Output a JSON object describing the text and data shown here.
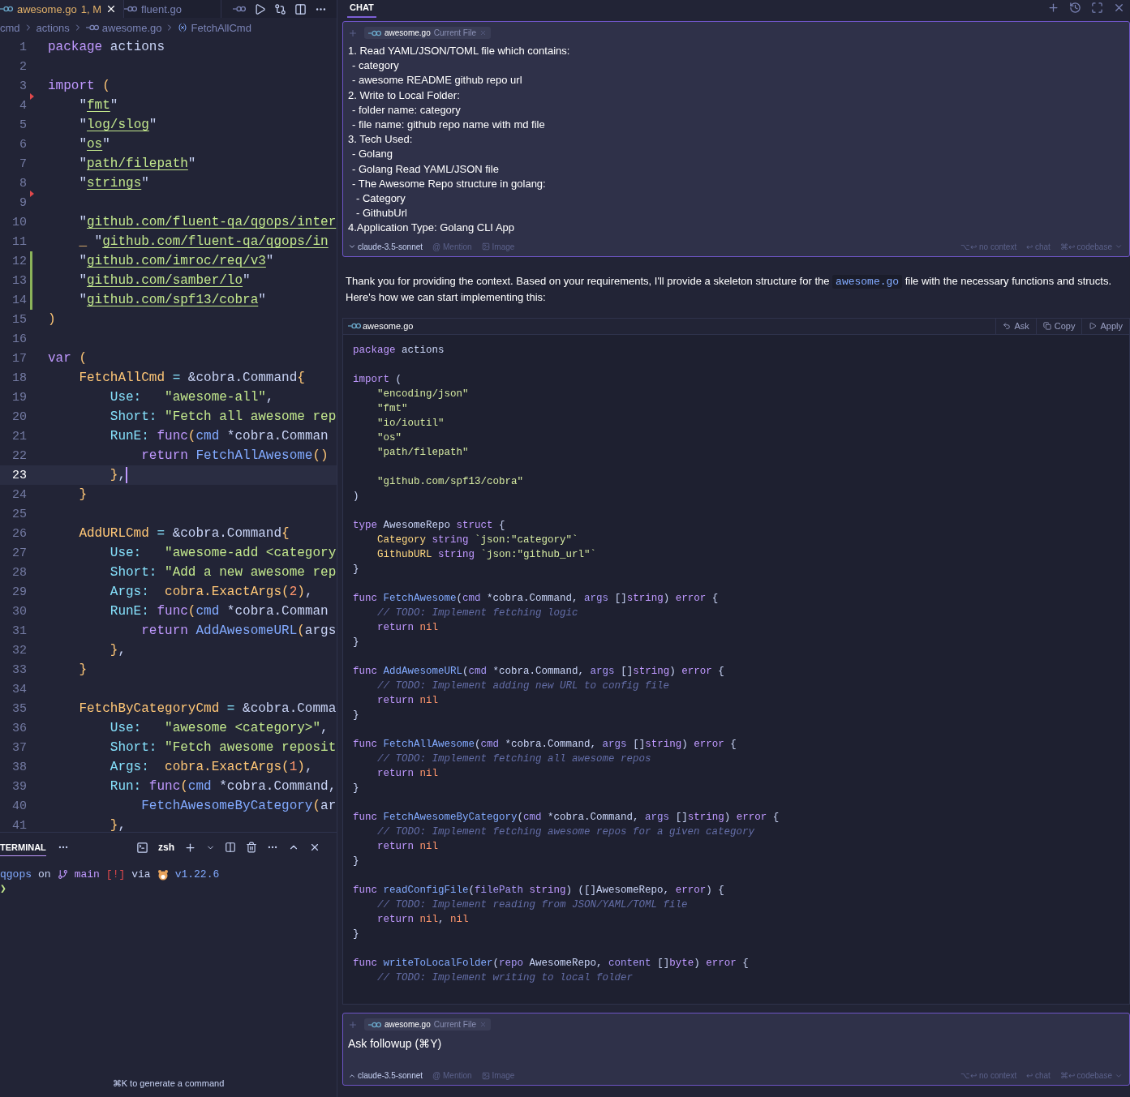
{
  "editor": {
    "tabs": [
      {
        "label": "awesome.go",
        "badge": "1, M",
        "selected": true
      },
      {
        "label": "fluent.go",
        "selected": false
      }
    ],
    "breadcrumb": [
      "cmd",
      "actions",
      "awesome.go",
      "FetchAllCmd"
    ],
    "lines": [
      {
        "number": "1",
        "active": false,
        "tokens": [
          {
            "kind": "k",
            "text": "package"
          },
          {
            "kind": "x",
            "text": " actions"
          }
        ]
      },
      {
        "number": "2",
        "active": false
      },
      {
        "number": "3",
        "active": false,
        "tokens": [
          {
            "kind": "k",
            "text": "import"
          },
          {
            "kind": "o",
            "text": " ("
          }
        ]
      },
      {
        "number": "4",
        "active": false,
        "kind": "deleted",
        "tokens": [
          {
            "kind": "x",
            "text": "    \""
          },
          {
            "kind": "u",
            "text": "fmt"
          },
          {
            "kind": "x",
            "text": "\""
          }
        ]
      },
      {
        "number": "5",
        "active": false,
        "tokens": [
          {
            "kind": "x",
            "text": "    \""
          },
          {
            "kind": "u",
            "text": "log/slog"
          },
          {
            "kind": "x",
            "text": "\""
          }
        ]
      },
      {
        "number": "6",
        "active": false,
        "tokens": [
          {
            "kind": "x",
            "text": "    \""
          },
          {
            "kind": "u",
            "text": "os"
          },
          {
            "kind": "x",
            "text": "\""
          }
        ]
      },
      {
        "number": "7",
        "active": false,
        "tokens": [
          {
            "kind": "x",
            "text": "    \""
          },
          {
            "kind": "u",
            "text": "path/filepath"
          },
          {
            "kind": "x",
            "text": "\""
          }
        ]
      },
      {
        "number": "8",
        "active": false,
        "tokens": [
          {
            "kind": "x",
            "text": "    \""
          },
          {
            "kind": "u",
            "text": "strings"
          },
          {
            "kind": "x",
            "text": "\""
          }
        ]
      },
      {
        "number": "9",
        "active": false,
        "kind": "deleted"
      },
      {
        "number": "10",
        "active": false,
        "tokens": [
          {
            "kind": "x",
            "text": "    \""
          },
          {
            "kind": "u",
            "text": "github.com/fluent-qa/qgops/inter"
          }
        ]
      },
      {
        "number": "11",
        "active": false,
        "tokens": [
          {
            "kind": "o",
            "text": "    _"
          },
          {
            "kind": "x",
            "text": " \""
          },
          {
            "kind": "u",
            "text": "github.com/fluent-qa/qgops/in"
          }
        ]
      },
      {
        "number": "12",
        "active": false,
        "kind": "added",
        "tokens": [
          {
            "kind": "x",
            "text": "    \""
          },
          {
            "kind": "u",
            "text": "github.com/imroc/req/v3"
          },
          {
            "kind": "x",
            "text": "\""
          }
        ]
      },
      {
        "number": "13",
        "active": false,
        "kind": "added",
        "tokens": [
          {
            "kind": "x",
            "text": "    \""
          },
          {
            "kind": "u",
            "text": "github.com/samber/lo"
          },
          {
            "kind": "x",
            "text": "\""
          }
        ]
      },
      {
        "number": "14",
        "active": false,
        "kind": "added",
        "tokens": [
          {
            "kind": "x",
            "text": "    \""
          },
          {
            "kind": "u",
            "text": "github.com/spf13/cobra"
          },
          {
            "kind": "x",
            "text": "\""
          }
        ]
      },
      {
        "number": "15",
        "active": false,
        "tokens": [
          {
            "kind": "o",
            "text": ")"
          }
        ]
      },
      {
        "number": "16",
        "active": false
      },
      {
        "number": "17",
        "active": false,
        "tokens": [
          {
            "kind": "k",
            "text": "var"
          },
          {
            "kind": "o",
            "text": " ("
          }
        ]
      },
      {
        "number": "18",
        "active": false,
        "tokens": [
          {
            "kind": "v",
            "text": "    FetchAllCmd"
          },
          {
            "kind": "y",
            "text": " = "
          },
          {
            "kind": "x",
            "text": "&cobra.Command"
          },
          {
            "kind": "o",
            "text": "{"
          }
        ]
      },
      {
        "number": "19",
        "active": false,
        "tokens": [
          {
            "kind": "y",
            "text": "        Use:"
          },
          {
            "kind": "s",
            "text": "   \"awesome-all\""
          },
          {
            "kind": "x",
            "text": ","
          }
        ]
      },
      {
        "number": "20",
        "active": false,
        "tokens": [
          {
            "kind": "y",
            "text": "        Short:"
          },
          {
            "kind": "s",
            "text": " \"Fetch all awesome rep"
          }
        ]
      },
      {
        "number": "21",
        "active": false,
        "tokens": [
          {
            "kind": "y",
            "text": "        RunE:"
          },
          {
            "kind": "k",
            "text": " func"
          },
          {
            "kind": "o",
            "text": "("
          },
          {
            "kind": "p",
            "text": "cmd"
          },
          {
            "kind": "x",
            "text": " *cobra.Comman"
          }
        ]
      },
      {
        "number": "22",
        "active": false,
        "tokens": [
          {
            "kind": "k",
            "text": "            return"
          },
          {
            "kind": "f",
            "text": " FetchAllAwesome"
          },
          {
            "kind": "o",
            "text": "()"
          }
        ]
      },
      {
        "number": "23",
        "active": true,
        "tokens": [
          {
            "kind": "o",
            "text": "        }"
          },
          {
            "kind": "x",
            "text": ","
          }
        ]
      },
      {
        "number": "24",
        "active": false,
        "tokens": [
          {
            "kind": "o",
            "text": "    }"
          }
        ]
      },
      {
        "number": "25",
        "active": false
      },
      {
        "number": "26",
        "active": false,
        "tokens": [
          {
            "kind": "v",
            "text": "    AddURLCmd"
          },
          {
            "kind": "y",
            "text": " = "
          },
          {
            "kind": "x",
            "text": "&cobra.Command"
          },
          {
            "kind": "o",
            "text": "{"
          }
        ]
      },
      {
        "number": "27",
        "active": false,
        "tokens": [
          {
            "kind": "y",
            "text": "        Use:"
          },
          {
            "kind": "s",
            "text": "   \"awesome-add <category"
          }
        ]
      },
      {
        "number": "28",
        "active": false,
        "tokens": [
          {
            "kind": "y",
            "text": "        Short:"
          },
          {
            "kind": "s",
            "text": " \"Add a new awesome rep"
          }
        ]
      },
      {
        "number": "29",
        "active": false,
        "tokens": [
          {
            "kind": "y",
            "text": "        Args:"
          },
          {
            "kind": "v",
            "text": "  cobra.ExactArgs"
          },
          {
            "kind": "o",
            "text": "("
          },
          {
            "kind": "n",
            "text": "2"
          },
          {
            "kind": "o",
            "text": ")"
          },
          {
            "kind": "x",
            "text": ","
          }
        ]
      },
      {
        "number": "30",
        "active": false,
        "tokens": [
          {
            "kind": "y",
            "text": "        RunE:"
          },
          {
            "kind": "k",
            "text": " func"
          },
          {
            "kind": "o",
            "text": "("
          },
          {
            "kind": "p",
            "text": "cmd"
          },
          {
            "kind": "x",
            "text": " *cobra.Comman"
          }
        ]
      },
      {
        "number": "31",
        "active": false,
        "tokens": [
          {
            "kind": "k",
            "text": "            return"
          },
          {
            "kind": "f",
            "text": " AddAwesomeURL"
          },
          {
            "kind": "o",
            "text": "("
          },
          {
            "kind": "x",
            "text": "args"
          }
        ]
      },
      {
        "number": "32",
        "active": false,
        "tokens": [
          {
            "kind": "o",
            "text": "        }"
          },
          {
            "kind": "x",
            "text": ","
          }
        ]
      },
      {
        "number": "33",
        "active": false,
        "tokens": [
          {
            "kind": "o",
            "text": "    }"
          }
        ]
      },
      {
        "number": "34",
        "active": false
      },
      {
        "number": "35",
        "active": false,
        "tokens": [
          {
            "kind": "v",
            "text": "    FetchByCategoryCmd"
          },
          {
            "kind": "y",
            "text": " = "
          },
          {
            "kind": "x",
            "text": "&cobra.Comma"
          }
        ]
      },
      {
        "number": "36",
        "active": false,
        "tokens": [
          {
            "kind": "y",
            "text": "        Use:"
          },
          {
            "kind": "s",
            "text": "   \"awesome <category>\""
          },
          {
            "kind": "x",
            "text": ","
          }
        ]
      },
      {
        "number": "37",
        "active": false,
        "tokens": [
          {
            "kind": "y",
            "text": "        Short:"
          },
          {
            "kind": "s",
            "text": " \"Fetch awesome reposit"
          }
        ]
      },
      {
        "number": "38",
        "active": false,
        "tokens": [
          {
            "kind": "y",
            "text": "        Args:"
          },
          {
            "kind": "v",
            "text": "  cobra.ExactArgs"
          },
          {
            "kind": "o",
            "text": "("
          },
          {
            "kind": "n",
            "text": "1"
          },
          {
            "kind": "o",
            "text": ")"
          },
          {
            "kind": "x",
            "text": ","
          }
        ]
      },
      {
        "number": "39",
        "active": false,
        "tokens": [
          {
            "kind": "y",
            "text": "        Run:"
          },
          {
            "kind": "k",
            "text": " func"
          },
          {
            "kind": "o",
            "text": "("
          },
          {
            "kind": "p",
            "text": "cmd"
          },
          {
            "kind": "x",
            "text": " *cobra.Command,"
          }
        ]
      },
      {
        "number": "40",
        "active": false,
        "tokens": [
          {
            "kind": "f",
            "text": "            FetchAwesomeByCategory"
          },
          {
            "kind": "o",
            "text": "("
          },
          {
            "kind": "x",
            "text": "ar"
          }
        ]
      },
      {
        "number": "41",
        "active": false,
        "tokens": [
          {
            "kind": "o",
            "text": "        }"
          },
          {
            "kind": "x",
            "text": ","
          }
        ]
      }
    ]
  },
  "terminal": {
    "tabs": [
      {
        "label": "TERMINAL",
        "selected": true
      }
    ],
    "shell": "zsh",
    "prompt": {
      "dir": "qgops",
      "on": "on",
      "branch": "main",
      "status": "[!]",
      "via": "via",
      "version": "v1.22.6",
      "symbol": "❯"
    },
    "hint": "⌘K to generate a command"
  },
  "chat": {
    "tabs": [
      {
        "label": "CHAT",
        "selected": true
      }
    ],
    "context_message": {
      "chip": {
        "file": "awesome.go",
        "label": "Current File"
      },
      "items": [
        {
          "text": "1. Read YAML/JSON/TOML file which contains:",
          "children": [
            {
              "text": "- category"
            },
            {
              "text": "- awesome README github repo url"
            }
          ]
        },
        {
          "text": "2. Write to Local Folder:",
          "children": [
            {
              "text": "- folder name: category"
            },
            {
              "text": "- file name: github repo name with md file"
            }
          ]
        },
        {
          "text": "3. Tech Used:",
          "children": [
            {
              "text": "- Golang"
            },
            {
              "text": "- Golang Read YAML/JSON file"
            },
            {
              "text": "- The Awesome Repo structure in golang:",
              "children": [
                {
                  "text": "- Category"
                },
                {
                  "text": "- GithubUrl"
                }
              ]
            }
          ]
        },
        {
          "text": "4.Application Type: Golang CLI App"
        }
      ],
      "footer": {
        "model": "claude-3.5-sonnet",
        "mention": "@ Mention",
        "image": "Image",
        "shortcuts": [
          {
            "keys": "⌥↩",
            "label": "no context"
          },
          {
            "keys": "↩",
            "label": "chat"
          },
          {
            "keys": "⌘↩",
            "label": "codebase"
          }
        ]
      }
    },
    "response": {
      "before": "Thank you for providing the context. Based on your requirements, I'll provide a skeleton structure for the ",
      "code": "awesome.go",
      "after": " file with the necessary functions and structs. Here's how we can start implementing this:"
    },
    "code_block": {
      "file": "awesome.go",
      "actions": [
        "Ask",
        "Copy",
        "Apply"
      ],
      "lines": [
        {
          "kind": "code",
          "tokens": [
            {
              "kind": "k",
              "text": "package"
            },
            {
              "kind": "x",
              "text": " actions"
            }
          ]
        },
        {
          "kind": "blank"
        },
        {
          "kind": "code",
          "tokens": [
            {
              "kind": "k",
              "text": "import"
            },
            {
              "kind": "x",
              "text": " ("
            }
          ]
        },
        {
          "kind": "code",
          "tokens": [
            {
              "kind": "s",
              "text": "    \"encoding/json\""
            }
          ]
        },
        {
          "kind": "code",
          "tokens": [
            {
              "kind": "s",
              "text": "    \"fmt\""
            }
          ]
        },
        {
          "kind": "code",
          "tokens": [
            {
              "kind": "s",
              "text": "    \"io/ioutil\""
            }
          ]
        },
        {
          "kind": "code",
          "tokens": [
            {
              "kind": "s",
              "text": "    \"os\""
            }
          ]
        },
        {
          "kind": "code",
          "tokens": [
            {
              "kind": "s",
              "text": "    \"path/filepath\""
            }
          ]
        },
        {
          "kind": "blank"
        },
        {
          "kind": "code",
          "tokens": [
            {
              "kind": "s",
              "text": "    \"github.com/spf13/cobra\""
            }
          ]
        },
        {
          "kind": "code",
          "tokens": [
            {
              "kind": "x",
              "text": ")"
            }
          ]
        },
        {
          "kind": "blank"
        },
        {
          "kind": "code",
          "tokens": [
            {
              "kind": "k",
              "text": "type"
            },
            {
              "kind": "x",
              "text": " AwesomeRepo "
            },
            {
              "kind": "k",
              "text": "struct"
            },
            {
              "kind": "x",
              "text": " {"
            }
          ]
        },
        {
          "kind": "code",
          "tokens": [
            {
              "kind": "t",
              "text": "    Category"
            },
            {
              "kind": "k",
              "text": " string"
            },
            {
              "kind": "s",
              "text": " `json:\"category\"`"
            }
          ]
        },
        {
          "kind": "code",
          "tokens": [
            {
              "kind": "t",
              "text": "    GithubURL"
            },
            {
              "kind": "k",
              "text": " string"
            },
            {
              "kind": "s",
              "text": " `json:\"github_url\"`"
            }
          ]
        },
        {
          "kind": "code",
          "tokens": [
            {
              "kind": "x",
              "text": "}"
            }
          ]
        },
        {
          "kind": "blank"
        },
        {
          "kind": "code",
          "tokens": [
            {
              "kind": "k",
              "text": "func"
            },
            {
              "kind": "f",
              "text": " FetchAwesome"
            },
            {
              "kind": "x",
              "text": "("
            },
            {
              "kind": "p",
              "text": "cmd"
            },
            {
              "kind": "x",
              "text": " *cobra.Command, "
            },
            {
              "kind": "p",
              "text": "args"
            },
            {
              "kind": "x",
              "text": " []"
            },
            {
              "kind": "k",
              "text": "string"
            },
            {
              "kind": "x",
              "text": ") "
            },
            {
              "kind": "k",
              "text": "error"
            },
            {
              "kind": "x",
              "text": " {"
            }
          ]
        },
        {
          "kind": "code",
          "tokens": [
            {
              "kind": "c",
              "text": "    // TODO: Implement fetching logic"
            }
          ]
        },
        {
          "kind": "code",
          "tokens": [
            {
              "kind": "k",
              "text": "    return"
            },
            {
              "kind": "n",
              "text": " nil"
            }
          ]
        },
        {
          "kind": "code",
          "tokens": [
            {
              "kind": "x",
              "text": "}"
            }
          ]
        },
        {
          "kind": "blank"
        },
        {
          "kind": "code",
          "tokens": [
            {
              "kind": "k",
              "text": "func"
            },
            {
              "kind": "f",
              "text": " AddAwesomeURL"
            },
            {
              "kind": "x",
              "text": "("
            },
            {
              "kind": "p",
              "text": "cmd"
            },
            {
              "kind": "x",
              "text": " *cobra.Command, "
            },
            {
              "kind": "p",
              "text": "args"
            },
            {
              "kind": "x",
              "text": " []"
            },
            {
              "kind": "k",
              "text": "string"
            },
            {
              "kind": "x",
              "text": ") "
            },
            {
              "kind": "k",
              "text": "error"
            },
            {
              "kind": "x",
              "text": " {"
            }
          ]
        },
        {
          "kind": "code",
          "tokens": [
            {
              "kind": "c",
              "text": "    // TODO: Implement adding new URL to config file"
            }
          ]
        },
        {
          "kind": "code",
          "tokens": [
            {
              "kind": "k",
              "text": "    return"
            },
            {
              "kind": "n",
              "text": " nil"
            }
          ]
        },
        {
          "kind": "code",
          "tokens": [
            {
              "kind": "x",
              "text": "}"
            }
          ]
        },
        {
          "kind": "blank"
        },
        {
          "kind": "code",
          "tokens": [
            {
              "kind": "k",
              "text": "func"
            },
            {
              "kind": "f",
              "text": " FetchAllAwesome"
            },
            {
              "kind": "x",
              "text": "("
            },
            {
              "kind": "p",
              "text": "cmd"
            },
            {
              "kind": "x",
              "text": " *cobra.Command, "
            },
            {
              "kind": "p",
              "text": "args"
            },
            {
              "kind": "x",
              "text": " []"
            },
            {
              "kind": "k",
              "text": "string"
            },
            {
              "kind": "x",
              "text": ") "
            },
            {
              "kind": "k",
              "text": "error"
            },
            {
              "kind": "x",
              "text": " {"
            }
          ]
        },
        {
          "kind": "code",
          "tokens": [
            {
              "kind": "c",
              "text": "    // TODO: Implement fetching all awesome repos"
            }
          ]
        },
        {
          "kind": "code",
          "tokens": [
            {
              "kind": "k",
              "text": "    return"
            },
            {
              "kind": "n",
              "text": " nil"
            }
          ]
        },
        {
          "kind": "code",
          "tokens": [
            {
              "kind": "x",
              "text": "}"
            }
          ]
        },
        {
          "kind": "blank"
        },
        {
          "kind": "code",
          "tokens": [
            {
              "kind": "k",
              "text": "func"
            },
            {
              "kind": "f",
              "text": " FetchAwesomeByCategory"
            },
            {
              "kind": "x",
              "text": "("
            },
            {
              "kind": "p",
              "text": "cmd"
            },
            {
              "kind": "x",
              "text": " *cobra.Command, "
            },
            {
              "kind": "p",
              "text": "args"
            },
            {
              "kind": "x",
              "text": " []"
            },
            {
              "kind": "k",
              "text": "string"
            },
            {
              "kind": "x",
              "text": ") "
            },
            {
              "kind": "k",
              "text": "error"
            },
            {
              "kind": "x",
              "text": " {"
            }
          ]
        },
        {
          "kind": "code",
          "tokens": [
            {
              "kind": "c",
              "text": "    // TODO: Implement fetching awesome repos for a given category"
            }
          ]
        },
        {
          "kind": "code",
          "tokens": [
            {
              "kind": "k",
              "text": "    return"
            },
            {
              "kind": "n",
              "text": " nil"
            }
          ]
        },
        {
          "kind": "code",
          "tokens": [
            {
              "kind": "x",
              "text": "}"
            }
          ]
        },
        {
          "kind": "blank"
        },
        {
          "kind": "code",
          "tokens": [
            {
              "kind": "k",
              "text": "func"
            },
            {
              "kind": "f",
              "text": " readConfigFile"
            },
            {
              "kind": "x",
              "text": "("
            },
            {
              "kind": "p",
              "text": "filePath"
            },
            {
              "kind": "k",
              "text": " string"
            },
            {
              "kind": "x",
              "text": ") ([]AwesomeRepo, "
            },
            {
              "kind": "k",
              "text": "error"
            },
            {
              "kind": "x",
              "text": ") {"
            }
          ]
        },
        {
          "kind": "code",
          "tokens": [
            {
              "kind": "c",
              "text": "    // TODO: Implement reading from JSON/YAML/TOML file"
            }
          ]
        },
        {
          "kind": "code",
          "tokens": [
            {
              "kind": "k",
              "text": "    return"
            },
            {
              "kind": "n",
              "text": " nil"
            },
            {
              "kind": "x",
              "text": ", "
            },
            {
              "kind": "n",
              "text": "nil"
            }
          ]
        },
        {
          "kind": "code",
          "tokens": [
            {
              "kind": "x",
              "text": "}"
            }
          ]
        },
        {
          "kind": "blank"
        },
        {
          "kind": "code",
          "tokens": [
            {
              "kind": "k",
              "text": "func"
            },
            {
              "kind": "f",
              "text": " writeToLocalFolder"
            },
            {
              "kind": "x",
              "text": "("
            },
            {
              "kind": "p",
              "text": "repo"
            },
            {
              "kind": "x",
              "text": " AwesomeRepo, "
            },
            {
              "kind": "p",
              "text": "content"
            },
            {
              "kind": "x",
              "text": " []"
            },
            {
              "kind": "k",
              "text": "byte"
            },
            {
              "kind": "x",
              "text": ") "
            },
            {
              "kind": "k",
              "text": "error"
            },
            {
              "kind": "x",
              "text": " {"
            }
          ]
        },
        {
          "kind": "code",
          "tokens": [
            {
              "kind": "c",
              "text": "    // TODO: Implement writing to local folder"
            }
          ]
        }
      ]
    },
    "followup": {
      "chip": {
        "file": "awesome.go",
        "label": "Current File"
      },
      "placeholder": "Ask followup (⌘Y)",
      "footer": {
        "model": "claude-3.5-sonnet",
        "mention": "@ Mention",
        "image": "Image",
        "shortcuts": [
          {
            "keys": "⌥↩",
            "label": "no context"
          },
          {
            "keys": "↩",
            "label": "chat"
          },
          {
            "keys": "⌘↩",
            "label": "codebase"
          }
        ]
      }
    }
  }
}
